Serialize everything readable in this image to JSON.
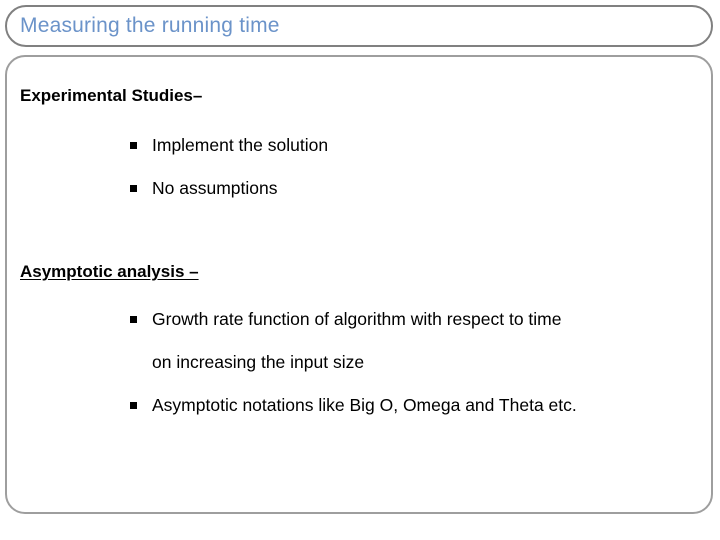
{
  "slide": {
    "title": "Measuring  the running time",
    "title_color": "#6b93c9",
    "frame_color": "#808080",
    "content_frame_color": "#9e9e9e",
    "background": "#ffffff"
  },
  "sections": [
    {
      "heading": "Experimental Studies–",
      "underlined": false,
      "bullets": [
        {
          "marker": "square-bullet",
          "text": "Implement the solution"
        },
        {
          "marker": "square-bullet",
          "text": "No assumptions"
        }
      ]
    },
    {
      "heading": "Asymptotic analysis –",
      "underlined": true,
      "bullets": [
        {
          "marker": "square-bullet",
          "text": "Growth rate function of algorithm with respect to time",
          "continuation": "on increasing the input size"
        },
        {
          "marker": "square-bullet",
          "text": "Asymptotic notations like Big O, Omega and Theta etc."
        }
      ]
    }
  ]
}
